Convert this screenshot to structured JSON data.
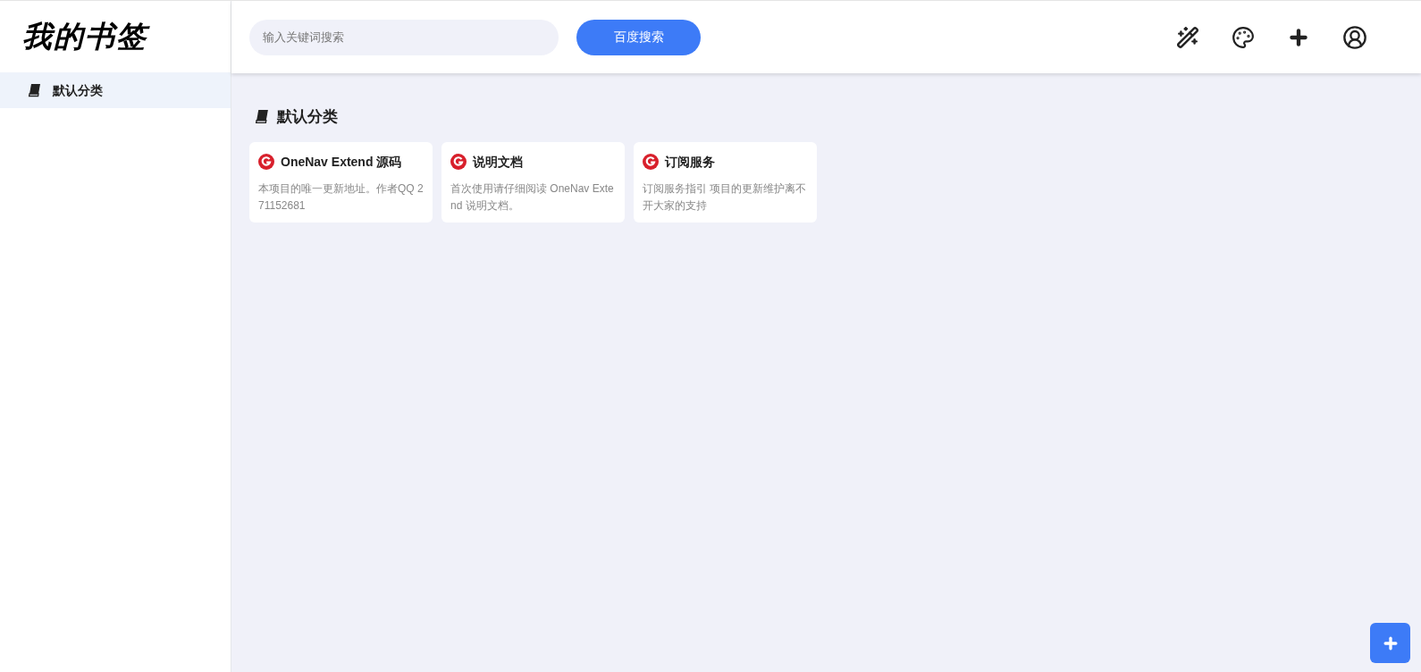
{
  "logo": "我的书签",
  "sidebar": {
    "items": [
      {
        "label": "默认分类",
        "selected": true
      }
    ]
  },
  "search": {
    "placeholder": "输入关键词搜索",
    "button": "百度搜索"
  },
  "category": {
    "title": "默认分类",
    "cards": [
      {
        "title": "OneNav Extend 源码",
        "description": "本项目的唯一更新地址。作者QQ 271152681"
      },
      {
        "title": "说明文档",
        "description": "首次使用请仔细阅读 OneNav Extend 说明文档。"
      },
      {
        "title": "订阅服务",
        "description": "订阅服务指引 项目的更新维护离不开大家的支持"
      }
    ]
  }
}
